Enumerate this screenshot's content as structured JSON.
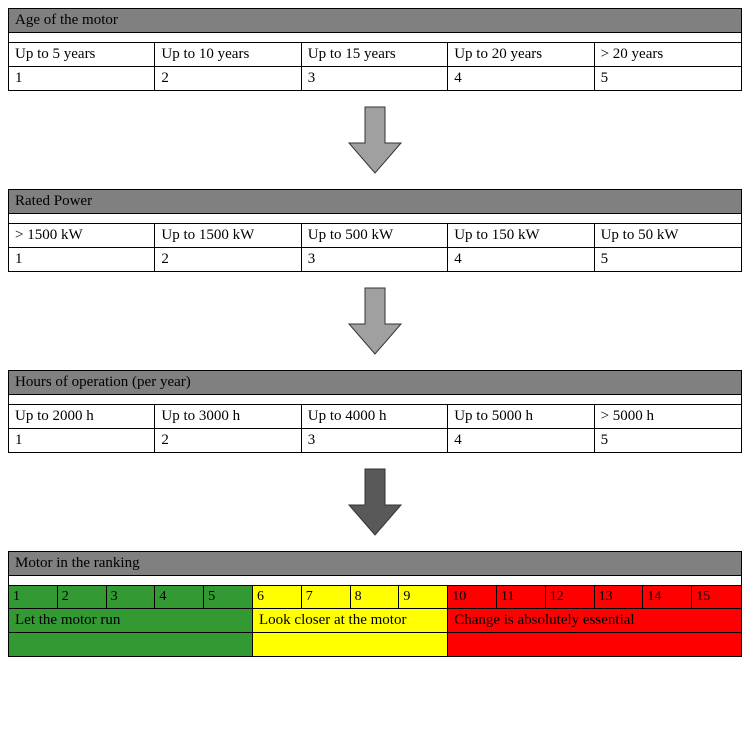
{
  "criteria": [
    {
      "title": "Age of the motor",
      "labels": [
        "Up to 5 years",
        "Up to 10 years",
        "Up to 15 years",
        "Up to 20 years",
        "> 20 years"
      ],
      "scores": [
        "1",
        "2",
        "3",
        "4",
        "5"
      ],
      "arrow_color": "#a0a0a0"
    },
    {
      "title": "Rated Power",
      "labels": [
        "> 1500 kW",
        "Up to 1500 kW",
        "Up to 500 kW",
        "Up to 150 kW",
        "Up to 50 kW"
      ],
      "scores": [
        "1",
        "2",
        "3",
        "4",
        "5"
      ],
      "arrow_color": "#a0a0a0"
    },
    {
      "title": "Hours of operation (per year)",
      "labels": [
        "Up to 2000 h",
        "Up to 3000 h",
        "Up to 4000 h",
        "Up to 5000 h",
        "> 5000 h"
      ],
      "scores": [
        "1",
        "2",
        "3",
        "4",
        "5"
      ],
      "arrow_color": "#595959"
    }
  ],
  "ranking": {
    "title": "Motor in the ranking",
    "zones": [
      {
        "color": "green",
        "scores": [
          "1",
          "2",
          "3",
          "4",
          "5"
        ],
        "message": "Let the motor run"
      },
      {
        "color": "yellow",
        "scores": [
          "6",
          "7",
          "8",
          "9"
        ],
        "message": "Look closer at the motor"
      },
      {
        "color": "red",
        "scores": [
          "10",
          "11",
          "12",
          "13",
          "14",
          "15"
        ],
        "message": "Change is absolutely essential"
      }
    ]
  }
}
